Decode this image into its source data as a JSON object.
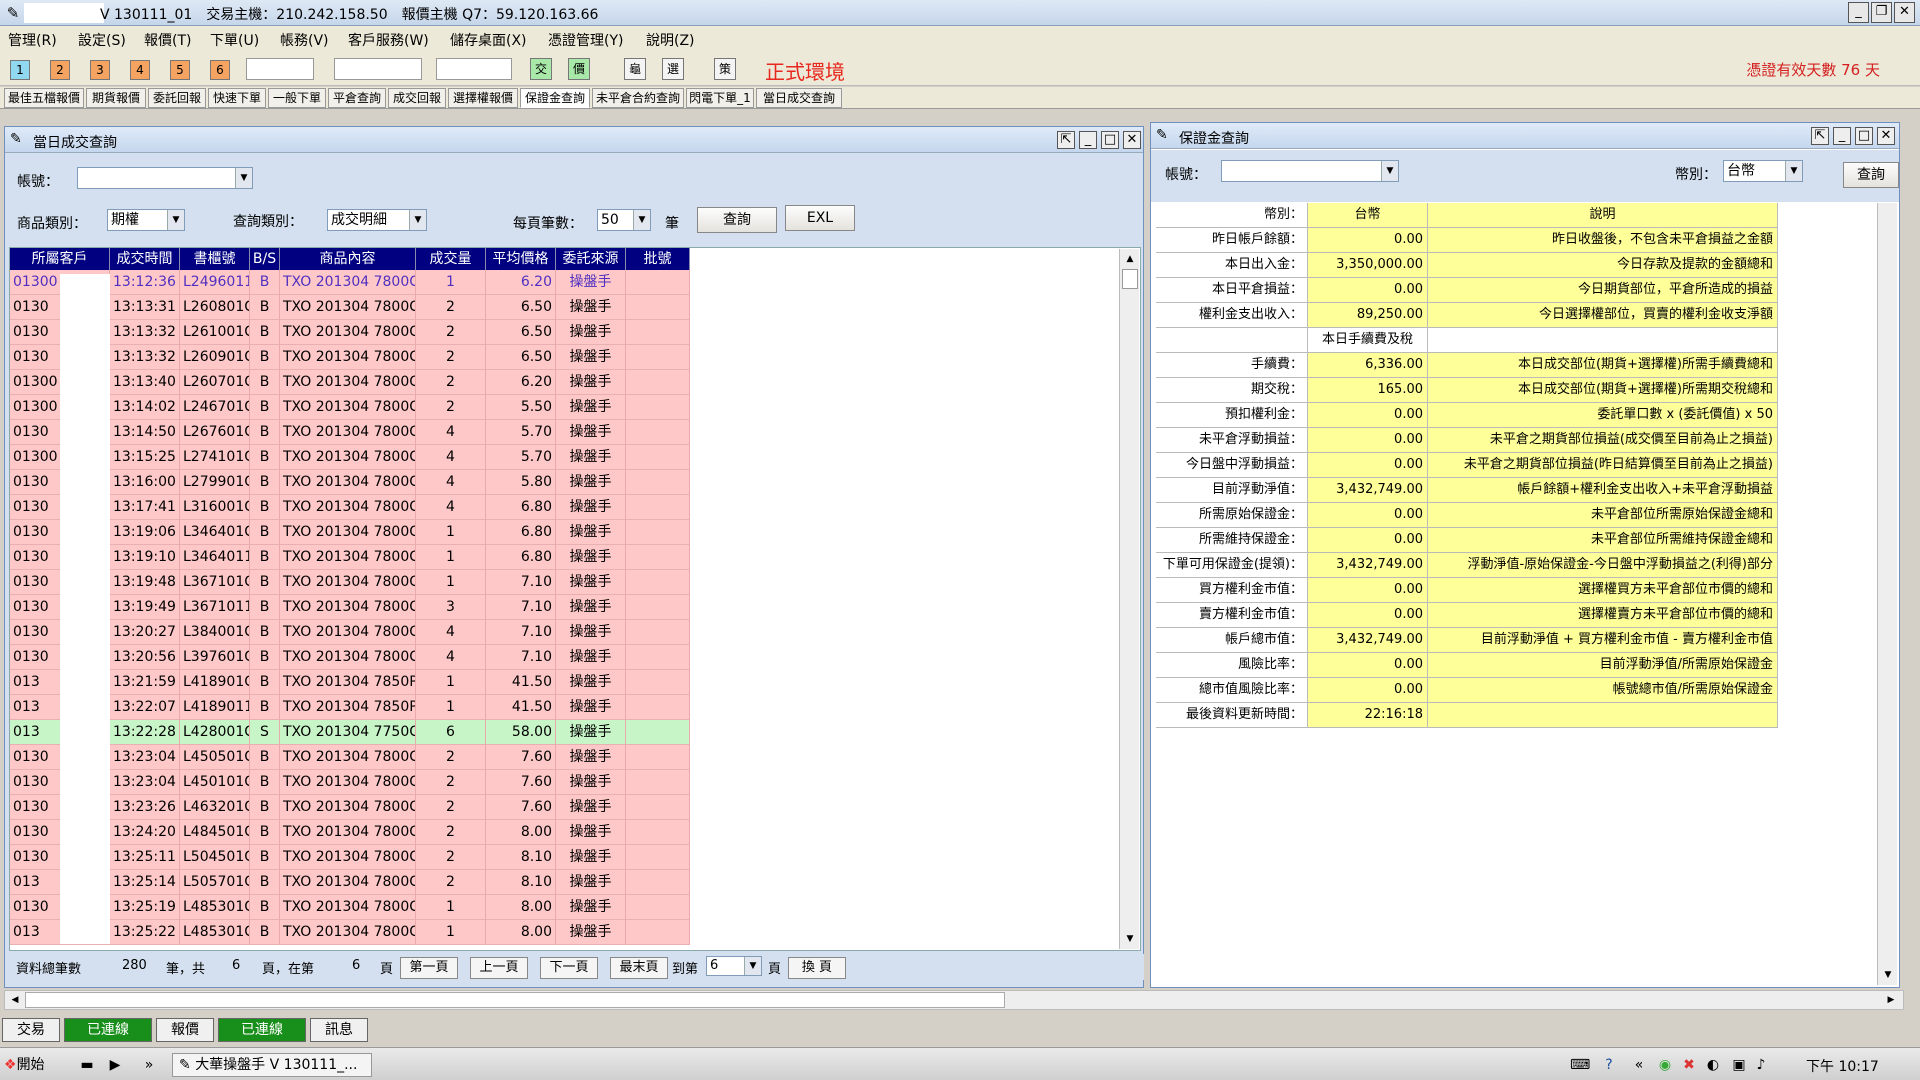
{
  "window": {
    "title": "V 130111_01　交易主機：210.242.158.50　報價主機 Q7：59.120.163.66"
  },
  "menu": [
    "管理(R)",
    "設定(S)",
    "報價(T)",
    "下單(U)",
    "帳務(V)",
    "客戶服務(W)",
    "儲存桌面(X)",
    "憑證管理(Y)",
    "說明(Z)"
  ],
  "toolbar": {
    "numbers": [
      "1",
      "2",
      "3",
      "4",
      "5",
      "6"
    ],
    "icons": [
      "交",
      "價",
      "龜",
      "選",
      "策"
    ],
    "environment": "正式環境",
    "cert_notice": "憑證有效天數  76  天"
  },
  "function_tabs": [
    "最佳五檔報價",
    "期貨報價",
    "委託回報",
    "快速下單",
    "一般下單",
    "平倉查詢",
    "成交回報",
    "選擇權報價",
    "保證金查詢",
    "未平倉合約查詢",
    "閃電下單_1",
    "當日成交查詢"
  ],
  "trade_panel": {
    "title": "當日成交查詢",
    "account_label": "帳號：",
    "product_label": "商品類別：",
    "product_value": "期權",
    "query_type_label": "查詢類別：",
    "query_type_value": "成交明細",
    "page_size_label": "每頁筆數：",
    "page_size_value": "50",
    "page_size_unit": "筆",
    "query_button": "查詢",
    "excel_button": "EXL",
    "columns": [
      "所屬客戶",
      "成交時間",
      "書櫃號",
      "B/S",
      "商品內容",
      "成交量",
      "平均價格",
      "委託來源",
      "批號"
    ],
    "rows": [
      [
        "01300",
        "13:12:36",
        "L2496011",
        "B",
        "TXO 201304 7800C",
        "1",
        "6.20",
        "操盤手",
        ""
      ],
      [
        "0130",
        "13:13:31",
        "L260801C",
        "B",
        "TXO 201304 7800C",
        "2",
        "6.50",
        "操盤手",
        ""
      ],
      [
        "0130",
        "13:13:32",
        "L261001C",
        "B",
        "TXO 201304 7800C",
        "2",
        "6.50",
        "操盤手",
        ""
      ],
      [
        "0130",
        "13:13:32",
        "L260901C",
        "B",
        "TXO 201304 7800C",
        "2",
        "6.50",
        "操盤手",
        ""
      ],
      [
        "01300",
        "13:13:40",
        "L260701C",
        "B",
        "TXO 201304 7800C",
        "2",
        "6.20",
        "操盤手",
        ""
      ],
      [
        "01300",
        "13:14:02",
        "L246701C",
        "B",
        "TXO 201304 7800C",
        "2",
        "5.50",
        "操盤手",
        ""
      ],
      [
        "0130",
        "13:14:50",
        "L267601C",
        "B",
        "TXO 201304 7800C",
        "4",
        "5.70",
        "操盤手",
        ""
      ],
      [
        "01300",
        "13:15:25",
        "L274101C",
        "B",
        "TXO 201304 7800C",
        "4",
        "5.70",
        "操盤手",
        ""
      ],
      [
        "0130",
        "13:16:00",
        "L279901C",
        "B",
        "TXO 201304 7800C",
        "4",
        "5.80",
        "操盤手",
        ""
      ],
      [
        "0130",
        "13:17:41",
        "L316001C",
        "B",
        "TXO 201304 7800C",
        "4",
        "6.80",
        "操盤手",
        ""
      ],
      [
        "0130",
        "13:19:06",
        "L346401C",
        "B",
        "TXO 201304 7800C",
        "1",
        "6.80",
        "操盤手",
        ""
      ],
      [
        "0130",
        "13:19:10",
        "L3464011",
        "B",
        "TXO 201304 7800C",
        "1",
        "6.80",
        "操盤手",
        ""
      ],
      [
        "0130",
        "13:19:48",
        "L367101C",
        "B",
        "TXO 201304 7800C",
        "1",
        "7.10",
        "操盤手",
        ""
      ],
      [
        "0130",
        "13:19:49",
        "L3671011",
        "B",
        "TXO 201304 7800C",
        "3",
        "7.10",
        "操盤手",
        ""
      ],
      [
        "0130",
        "13:20:27",
        "L384001C",
        "B",
        "TXO 201304 7800C",
        "4",
        "7.10",
        "操盤手",
        ""
      ],
      [
        "0130",
        "13:20:56",
        "L397601C",
        "B",
        "TXO 201304 7800C",
        "4",
        "7.10",
        "操盤手",
        ""
      ],
      [
        "013",
        "13:21:59",
        "L418901C",
        "B",
        "TXO 201304 7850P",
        "1",
        "41.50",
        "操盤手",
        ""
      ],
      [
        "013",
        "13:22:07",
        "L4189011",
        "B",
        "TXO 201304 7850P",
        "1",
        "41.50",
        "操盤手",
        ""
      ],
      [
        "013",
        "13:22:28",
        "L428001C",
        "S",
        "TXO 201304 7750C",
        "6",
        "58.00",
        "操盤手",
        ""
      ],
      [
        "0130",
        "13:23:04",
        "L450501C",
        "B",
        "TXO 201304 7800C",
        "2",
        "7.60",
        "操盤手",
        ""
      ],
      [
        "0130",
        "13:23:04",
        "L450101C",
        "B",
        "TXO 201304 7800C",
        "2",
        "7.60",
        "操盤手",
        ""
      ],
      [
        "0130",
        "13:23:26",
        "L463201C",
        "B",
        "TXO 201304 7800C",
        "2",
        "7.60",
        "操盤手",
        ""
      ],
      [
        "0130",
        "13:24:20",
        "L484501C",
        "B",
        "TXO 201304 7800C",
        "2",
        "8.00",
        "操盤手",
        ""
      ],
      [
        "0130",
        "13:25:11",
        "L504501C",
        "B",
        "TXO 201304 7800C",
        "2",
        "8.10",
        "操盤手",
        ""
      ],
      [
        "013",
        "13:25:14",
        "L505701C",
        "B",
        "TXO 201304 7800C",
        "2",
        "8.10",
        "操盤手",
        ""
      ],
      [
        "0130",
        "13:25:19",
        "L485301C",
        "B",
        "TXO 201304 7800C",
        "1",
        "8.00",
        "操盤手",
        ""
      ],
      [
        "013",
        "13:25:22",
        "L485301C",
        "B",
        "TXO 201304 7800C",
        "1",
        "8.00",
        "操盤手",
        ""
      ]
    ],
    "footer": {
      "total_label": "資料總筆數",
      "total_count": "280",
      "pages_mid": "筆，共",
      "pages_count": "6",
      "at_label": "頁，在第",
      "current_page": "6",
      "page_unit": "頁",
      "first_button": "第一頁",
      "prev_button": "上一頁",
      "next_button": "下一頁",
      "last_button": "最末頁",
      "goto_label": "到第",
      "goto_value": "6",
      "goto_unit": "頁",
      "change_button": "換 頁"
    }
  },
  "margin_panel": {
    "title": "保證金查詢",
    "account_label": "帳號：",
    "currency_label": "幣別：",
    "currency_value": "台幣",
    "query_button": "查詢",
    "header": [
      "幣別：",
      "台幣",
      "說明"
    ],
    "rows": [
      [
        "昨日帳戶餘額：",
        "0.00",
        "昨日收盤後，不包含未平倉損益之金額"
      ],
      [
        "本日出入金：",
        "3,350,000.00",
        "今日存款及提款的金額總和"
      ],
      [
        "本日平倉損益：",
        "0.00",
        "今日期貨部位，平倉所造成的損益"
      ],
      [
        "權利金支出收入：",
        "89,250.00",
        "今日選擇權部位，買賣的權利金收支淨額"
      ],
      [
        "",
        "本日手續費及稅",
        ""
      ],
      [
        "手續費：",
        "6,336.00",
        "本日成交部位(期貨+選擇權)所需手續費總和"
      ],
      [
        "期交稅：",
        "165.00",
        "本日成交部位(期貨+選擇權)所需期交稅總和"
      ],
      [
        "預扣權利金：",
        "0.00",
        "委託單口數 x (委託價值) x 50"
      ],
      [
        "未平倉浮動損益：",
        "0.00",
        "未平倉之期貨部位損益(成交價至目前為止之損益)"
      ],
      [
        "今日盤中浮動損益：",
        "0.00",
        "未平倉之期貨部位損益(昨日結算價至目前為止之損益)"
      ],
      [
        "目前浮動淨值：",
        "3,432,749.00",
        "帳戶餘額+權利金支出收入+未平倉浮動損益"
      ],
      [
        "所需原始保證金：",
        "0.00",
        "未平倉部位所需原始保證金總和"
      ],
      [
        "所需維持保證金：",
        "0.00",
        "未平倉部位所需維持保證金總和"
      ],
      [
        "下單可用保證金(提領)：",
        "3,432,749.00",
        "浮動淨值-原始保證金-今日盤中浮動損益之(利得)部分"
      ],
      [
        "買方權利金市值：",
        "0.00",
        "選擇權買方未平倉部位市價的總和"
      ],
      [
        "賣方權利金市值：",
        "0.00",
        "選擇權賣方未平倉部位市價的總和"
      ],
      [
        "帳戶總市值：",
        "3,432,749.00",
        "目前浮動淨值 + 買方權利金市值 - 賣方權利金市值"
      ],
      [
        "風險比率：",
        "0.00",
        "目前浮動淨值/所需原始保證金"
      ],
      [
        "總市值風險比率：",
        "0.00",
        "帳號總市值/所需原始保證金"
      ],
      [
        "最後資料更新時間：",
        "22:16:18",
        ""
      ]
    ]
  },
  "bottom_tabs": [
    "交易",
    "已連線",
    "報價",
    "已連線",
    "訊息"
  ],
  "taskbar": {
    "start": "開始",
    "task": "大華操盤手 V 130111_...",
    "clock": "下午 10:17"
  },
  "colors": {
    "row_buy": "#ffc8c8",
    "row_sell": "#c8f5c8",
    "grid_header": "#000080",
    "margin_cell": "#ffff99",
    "connected": "#188f1a",
    "env_red": "#e8281e"
  }
}
